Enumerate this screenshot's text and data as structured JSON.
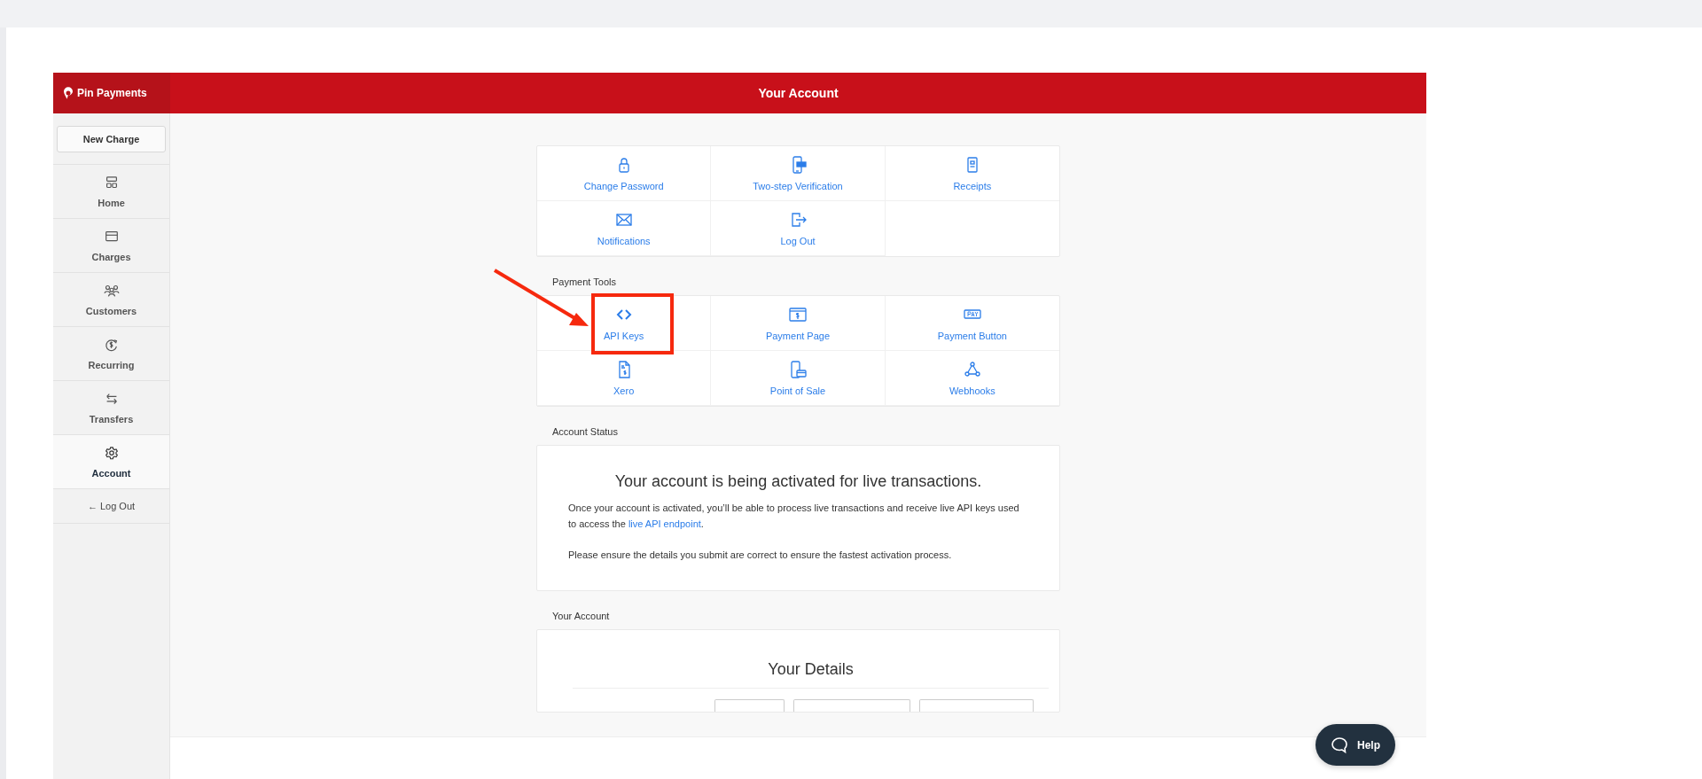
{
  "brand": "Pin Payments",
  "header": {
    "title": "Your Account"
  },
  "sidebar": {
    "new_charge": "New Charge",
    "items": [
      {
        "label": "Home",
        "selected": false
      },
      {
        "label": "Charges",
        "selected": false
      },
      {
        "label": "Customers",
        "selected": false
      },
      {
        "label": "Recurring",
        "selected": false
      },
      {
        "label": "Transfers",
        "selected": false
      },
      {
        "label": "Account",
        "selected": true
      }
    ],
    "log_out": "← Log Out"
  },
  "account_links": [
    {
      "label": "Change Password",
      "highlighted": false
    },
    {
      "label": "Two-step Verification",
      "highlighted": false
    },
    {
      "label": "Receipts",
      "highlighted": false
    },
    {
      "label": "Notifications",
      "highlighted": false
    },
    {
      "label": "Log Out",
      "highlighted": false
    }
  ],
  "payment_tools": {
    "title": "Payment Tools",
    "items": [
      {
        "label": "API Keys",
        "highlighted": true
      },
      {
        "label": "Payment Page",
        "highlighted": false
      },
      {
        "label": "Payment Button",
        "highlighted": false
      },
      {
        "label": "Xero",
        "highlighted": false
      },
      {
        "label": "Point of Sale",
        "highlighted": false
      },
      {
        "label": "Webhooks",
        "highlighted": false
      }
    ]
  },
  "account_status": {
    "title": "Account Status",
    "heading": "Your account is being activated for live transactions.",
    "paragraphs": [
      {
        "text": "Once your account is activated, you’ll be able to process live transactions and receive live API keys used to access the ",
        "link": "live API endpoint",
        "after": "."
      },
      {
        "text": "Please ensure the details you submit are correct to ensure the fastest activation process."
      }
    ]
  },
  "your_account": {
    "title": "Your Account",
    "heading": "Your Details"
  },
  "help_button": "Help"
}
